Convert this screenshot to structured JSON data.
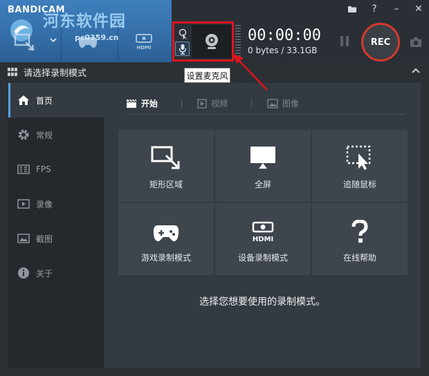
{
  "app": {
    "brand": "BANDICAM",
    "watermark_text": "河东软件园",
    "watermark_url": "pc0359.cn"
  },
  "toolbar": {
    "timer": "00:00:00",
    "size": "0 bytes / 33.1GB",
    "rec_label": "REC",
    "tooltip": "设置麦克风"
  },
  "section": {
    "title": "请选择录制模式"
  },
  "sidebar": {
    "items": [
      {
        "label": "首页",
        "icon": "home-icon",
        "active": true
      },
      {
        "label": "常规",
        "icon": "gear-icon"
      },
      {
        "label": "FPS",
        "icon": "fps-icon"
      },
      {
        "label": "录像",
        "icon": "video-icon"
      },
      {
        "label": "截图",
        "icon": "image-icon"
      },
      {
        "label": "关于",
        "icon": "info-icon"
      }
    ]
  },
  "main": {
    "tabs": [
      {
        "label": "开始",
        "active": true
      },
      {
        "label": "视频"
      },
      {
        "label": "图像"
      }
    ],
    "tiles": [
      {
        "label": "矩形区域",
        "icon": "rectangle-icon"
      },
      {
        "label": "全屏",
        "icon": "monitor-icon"
      },
      {
        "label": "追随鼠标",
        "icon": "cursor-follow-icon"
      },
      {
        "label": "游戏录制模式",
        "icon": "gamepad-icon"
      },
      {
        "label": "设备录制模式",
        "icon": "hdmi-icon"
      },
      {
        "label": "在线帮助",
        "icon": "question-icon"
      }
    ],
    "hint": "选择您想要使用的录制模式。"
  },
  "colors": {
    "accent": "#5aa3e6",
    "rec_ring": "#d8382f",
    "highlight_frame": "#e0141b",
    "logo_bg": "#3f7fbd"
  }
}
